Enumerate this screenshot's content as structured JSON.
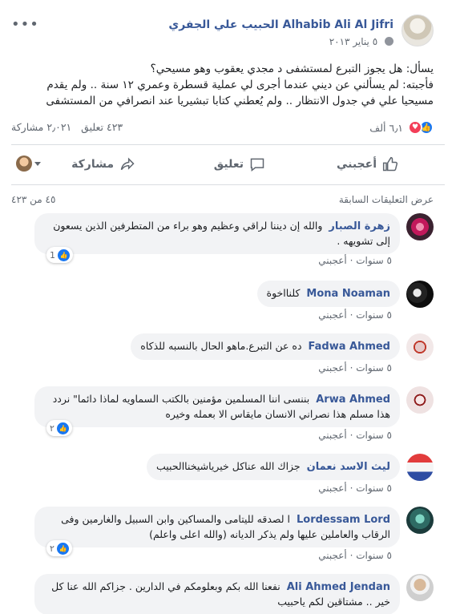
{
  "post": {
    "author": "Alhabib Ali Al Jifri الحبيب علي الجفري",
    "date": "٥ يناير ٢٠١٣",
    "privacy_icon": "globe-icon",
    "more_icon": "more-dots-icon",
    "text_line1": "يسأل: هل يجوز التبرع لمستشفى د مجدي يعقوب وهو مسيحي؟",
    "text_line2": "فأجبته: لم يسألني عن ديني عندما أجرى لي عملية قسطرة وعمري ١٢ سنة .. ولم يقدم مسيحيا علي في جدول الانتظار .. ولم يُعطني كتابا تبشيريا عند انصرافي من المستشفى"
  },
  "stats": {
    "reactions_count": "٦٫١ ألف",
    "comments_count": "٤٢٣ تعليق",
    "shares_count": "٢٫٠٢١ مشاركة"
  },
  "actions": {
    "like_label": "أعجبني",
    "comment_label": "تعليق",
    "share_label": "مشاركة"
  },
  "comments_section": {
    "previous_link": "عرض التعليقات السابقة",
    "shown_count": "٤٥ من ٤٢٣",
    "items": [
      {
        "name": "زهرة الصبار",
        "text": "والله إن ديننا لراقي وعظيم وهو براء من المتطرفين الذين يسعون إلى تشويهه .",
        "time": "٥ سنوات",
        "like_label": "أعجبني",
        "reactions": "1"
      },
      {
        "name": "Mona Noaman",
        "text": "كلنااخوة",
        "time": "٥ سنوات",
        "like_label": "أعجبني",
        "reactions": ""
      },
      {
        "name": "Fadwa Ahmed",
        "text": "ده عن التبرع.ماهو الحال بالنسبه للذكاه",
        "time": "٥ سنوات",
        "like_label": "أعجبني",
        "reactions": ""
      },
      {
        "name": "Arwa Ahmed",
        "text": "بننسى اننا المسلمين مؤمنين بالكتب السماويه لماذا دائما\" نردد هذا مسلم هذا نصراني الانسان مايقاس الا بعمله وخيره",
        "time": "٥ سنوات",
        "like_label": "أعجبني",
        "reactions": "٢"
      },
      {
        "name": "ليث الاسد نعمان",
        "text": "جزاك الله عناكل خيرياشيخناالحبيب",
        "time": "٥ سنوات",
        "like_label": "أعجبني",
        "reactions": ""
      },
      {
        "name": "Lordessam Lord",
        "text": "ا لصدقه لليتامى والمساكين وابن السبيل والغارمين وفى الرقاب والعاملين عليها ولم يذكر الديانه (والله اعلى واعلم)",
        "time": "٥ سنوات",
        "like_label": "أعجبني",
        "reactions": "٢"
      },
      {
        "name": "Ali Ahmed Jendan",
        "text": "نفعنا الله بكم وبعلومكم في الدارين . جزاكم الله عنا كل خير .. مشتاقين لكم ياحبيب",
        "time": "",
        "like_label": "",
        "reactions": ""
      }
    ]
  },
  "colors": {
    "link_blue": "#385898",
    "like_blue": "#1877f2",
    "love_red": "#f33e58",
    "bubble_gray": "#f2f3f5",
    "meta_gray": "#606770"
  }
}
